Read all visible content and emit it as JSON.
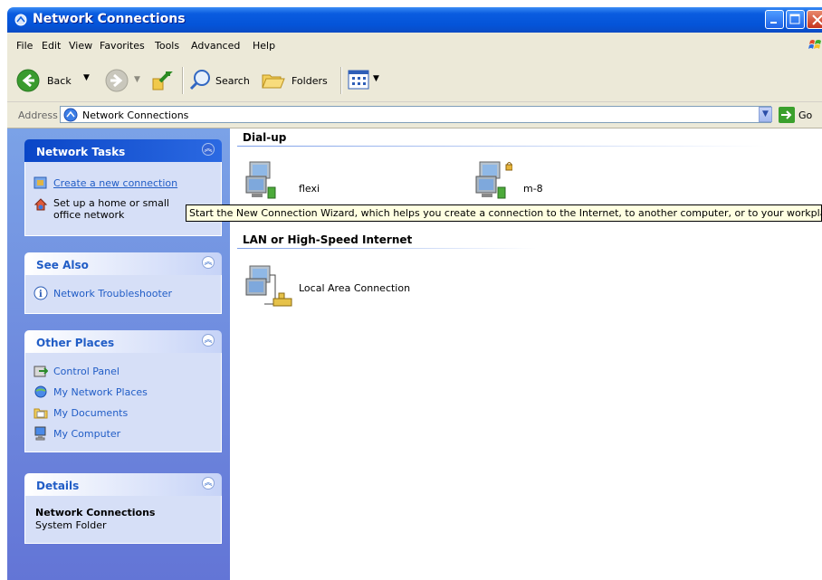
{
  "window": {
    "title": "Network Connections",
    "buttons": [
      "minimize",
      "maximize",
      "close"
    ]
  },
  "menu": [
    "File",
    "Edit",
    "View",
    "Favorites",
    "Tools",
    "Advanced",
    "Help"
  ],
  "toolbar": {
    "back": "Back",
    "search": "Search",
    "folders": "Folders"
  },
  "address": {
    "label": "Address",
    "value": "Network Connections",
    "go": "Go"
  },
  "sidebar": {
    "network_tasks": {
      "title": "Network Tasks",
      "items": [
        {
          "label": "Create a new connection",
          "icon": "new-connection-icon"
        },
        {
          "label": "Set up a home or small",
          "label2": "office network",
          "icon": "home-network-icon"
        }
      ]
    },
    "see_also": {
      "title": "See Also",
      "items": [
        {
          "label": "Network Troubleshooter",
          "icon": "info-icon"
        }
      ]
    },
    "other_places": {
      "title": "Other Places",
      "items": [
        {
          "label": "Control Panel",
          "icon": "control-panel-icon"
        },
        {
          "label": "My Network Places",
          "icon": "network-places-icon"
        },
        {
          "label": "My Documents",
          "icon": "documents-folder-icon"
        },
        {
          "label": "My Computer",
          "icon": "computer-icon"
        }
      ]
    },
    "details": {
      "title": "Details",
      "name": "Network Connections",
      "type": "System Folder"
    }
  },
  "content": {
    "groups": [
      {
        "title": "Dial-up",
        "items": [
          {
            "label": "flexi",
            "icon": "dialup-connection-icon"
          },
          {
            "label": "m-8",
            "icon": "dialup-connection-locked-icon"
          }
        ]
      },
      {
        "title": "LAN or High-Speed Internet",
        "items": [
          {
            "label": "Local Area Connection",
            "icon": "lan-connection-icon"
          }
        ]
      }
    ]
  },
  "tooltip": "Start the New Connection Wizard, which helps you create a connection to the Internet, to another computer, or to your workplac",
  "colors": {
    "titlebar": "#0454d8",
    "sidebar_bg": "#7ba2e7",
    "link": "#215dc6",
    "tooltip_bg": "#ffffe1"
  }
}
